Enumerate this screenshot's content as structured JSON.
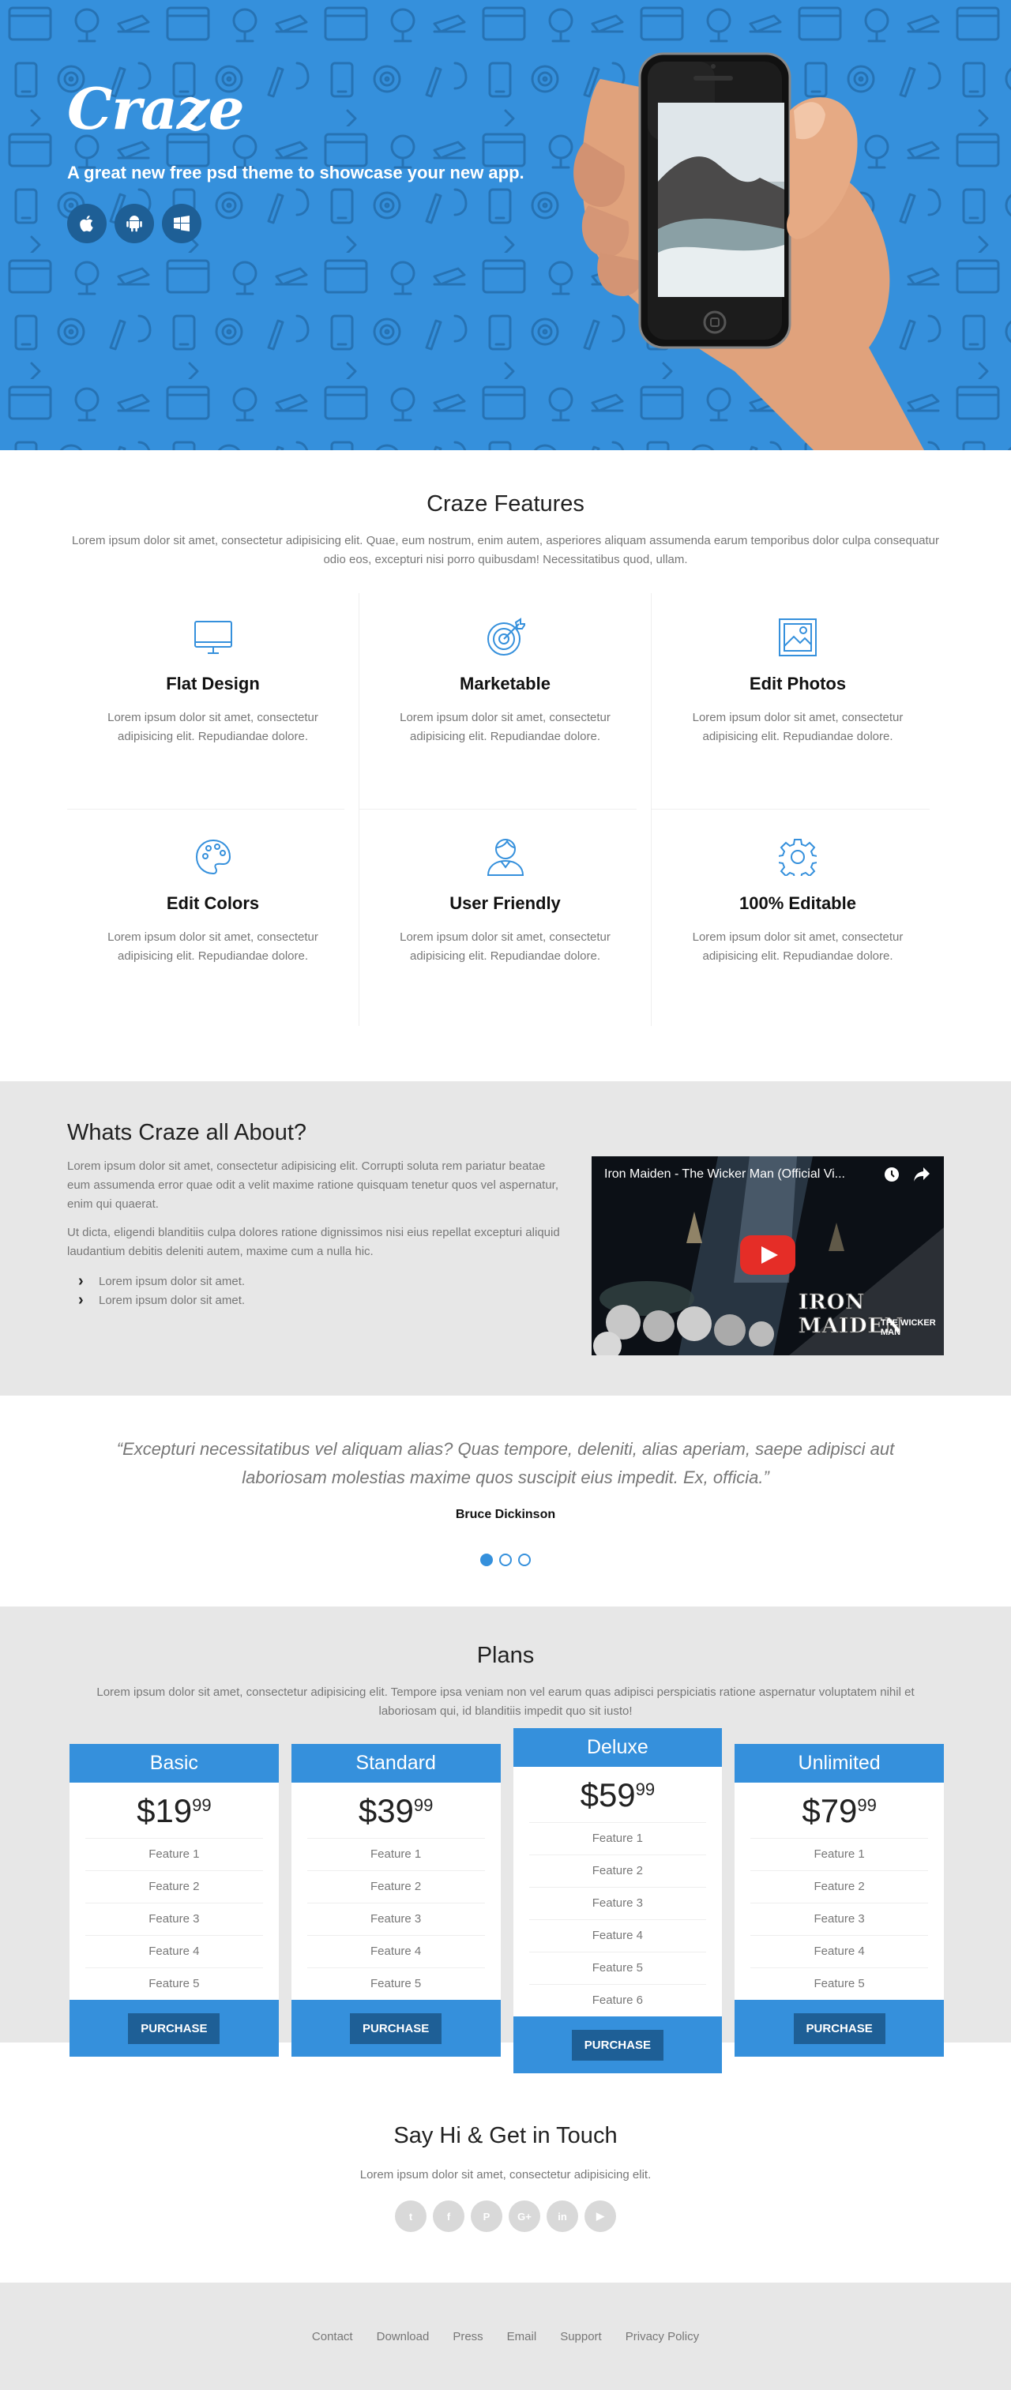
{
  "hero": {
    "logo": "Craze",
    "tagline": "A great new free psd theme to showcase your new app.",
    "background_color": "#3590dc",
    "platform_buttons": [
      {
        "icon": "apple-icon"
      },
      {
        "icon": "android-icon"
      },
      {
        "icon": "windows-icon"
      }
    ]
  },
  "features": {
    "title": "Craze Features",
    "subtitle": "Lorem ipsum dolor sit amet, consectetur adipisicing elit. Quae, eum nostrum, enim autem, asperiores aliquam assumenda earum temporibus dolor culpa consequatur odio eos, excepturi nisi porro quibusdam! Necessitatibus quod, ullam.",
    "items": [
      {
        "title": "Flat Design",
        "icon": "monitor-icon",
        "text": "Lorem ipsum dolor sit amet, consectetur adipisicing elit. Repudiandae dolore."
      },
      {
        "title": "Marketable",
        "icon": "target-icon",
        "text": "Lorem ipsum dolor sit amet, consectetur adipisicing elit. Repudiandae dolore."
      },
      {
        "title": "Edit Photos",
        "icon": "image-icon",
        "text": "Lorem ipsum dolor sit amet, consectetur adipisicing elit. Repudiandae dolore."
      },
      {
        "title": "Edit Colors",
        "icon": "palette-icon",
        "text": "Lorem ipsum dolor sit amet, consectetur adipisicing elit. Repudiandae dolore."
      },
      {
        "title": "User Friendly",
        "icon": "user-icon",
        "text": "Lorem ipsum dolor sit amet, consectetur adipisicing elit. Repudiandae dolore."
      },
      {
        "title": "100% Editable",
        "icon": "gear-icon",
        "text": "Lorem ipsum dolor sit amet, consectetur adipisicing elit. Repudiandae dolore."
      }
    ]
  },
  "about": {
    "title": "Whats Craze all About?",
    "paragraphs": [
      "Lorem ipsum dolor sit amet, consectetur adipisicing elit. Corrupti soluta rem pariatur beatae eum assumenda error quae odit a velit maxime ratione quisquam tenetur quos vel aspernatur, enim qui quaerat.",
      "Ut dicta, eligendi blanditiis culpa dolores ratione dignissimos nisi eius repellat excepturi aliquid laudantium debitis deleniti autem, maxime cum a nulla hic."
    ],
    "list": [
      "Lorem ipsum dolor sit amet.",
      "Lorem ipsum dolor sit amet."
    ],
    "video": {
      "title": "Iron Maiden - The Wicker Man (Official Vi...",
      "band": "IRON MAIDEN",
      "song": "THE WICKER MAN"
    }
  },
  "testimonial": {
    "quote": "“Excepturi necessitatibus vel aliquam alias? Quas tempore, deleniti, alias aperiam, saepe adipisci aut laboriosam molestias maxime quos suscipit eius impedit. Ex, officia.”",
    "author": "Bruce Dickinson",
    "active_dot": 0
  },
  "plans": {
    "title": "Plans",
    "subtitle": "Lorem ipsum dolor sit amet, consectetur adipisicing elit. Tempore ipsa veniam non vel earum quas adipisci perspiciatis ratione aspernatur voluptatem nihil et laboriosam qui, id blanditiis impedit quo sit iusto!",
    "buy_label": "PURCHASE",
    "items": [
      {
        "name": "Basic",
        "price": "$19",
        "cents": "99",
        "features": [
          "Feature 1",
          "Feature 2",
          "Feature 3",
          "Feature 4",
          "Feature 5"
        ]
      },
      {
        "name": "Standard",
        "price": "$39",
        "cents": "99",
        "features": [
          "Feature 1",
          "Feature 2",
          "Feature 3",
          "Feature 4",
          "Feature 5"
        ]
      },
      {
        "name": "Deluxe",
        "price": "$59",
        "cents": "99",
        "features": [
          "Feature 1",
          "Feature 2",
          "Feature 3",
          "Feature 4",
          "Feature 5",
          "Feature 6"
        ]
      },
      {
        "name": "Unlimited",
        "price": "$79",
        "cents": "99",
        "features": [
          "Feature 1",
          "Feature 2",
          "Feature 3",
          "Feature 4",
          "Feature 5"
        ]
      }
    ]
  },
  "contact": {
    "title": "Say Hi & Get in Touch",
    "subtitle": "Lorem ipsum dolor sit amet, consectetur adipisicing elit.",
    "socials": [
      {
        "icon": "twitter-icon",
        "glyph": "t"
      },
      {
        "icon": "facebook-icon",
        "glyph": "f"
      },
      {
        "icon": "pinterest-icon",
        "glyph": "P"
      },
      {
        "icon": "google-plus-icon",
        "glyph": "G+"
      },
      {
        "icon": "linkedin-icon",
        "glyph": "in"
      },
      {
        "icon": "youtube-icon",
        "glyph": "▶"
      }
    ]
  },
  "footer": {
    "links": [
      "Contact",
      "Download",
      "Press",
      "Email",
      "Support",
      "Privacy Policy"
    ]
  }
}
